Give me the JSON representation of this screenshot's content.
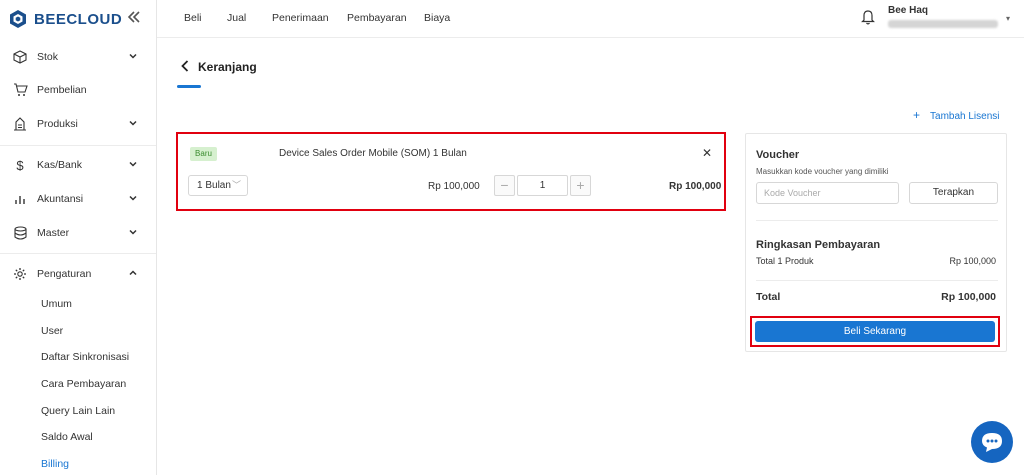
{
  "brand": {
    "name": "BEECLOUD"
  },
  "sidebar": {
    "items": [
      {
        "label": "Stok",
        "icon": "box-icon",
        "expandable": true
      },
      {
        "label": "Pembelian",
        "icon": "cart-icon",
        "expandable": false
      },
      {
        "label": "Produksi",
        "icon": "factory-icon",
        "expandable": true
      },
      {
        "label": "Kas/Bank",
        "icon": "dollar-icon",
        "expandable": true
      },
      {
        "label": "Akuntansi",
        "icon": "bar-chart-icon",
        "expandable": true
      },
      {
        "label": "Master",
        "icon": "database-icon",
        "expandable": true
      },
      {
        "label": "Pengaturan",
        "icon": "gear-icon",
        "expandable": true,
        "expanded": true
      }
    ],
    "sub_items": [
      "Umum",
      "User",
      "Daftar Sinkronisasi",
      "Cara Pembayaran",
      "Query Lain Lain",
      "Saldo Awal",
      "Billing"
    ],
    "active_sub_item": "Billing"
  },
  "topbar": {
    "menu": [
      "Beli",
      "Jual",
      "Penerimaan",
      "Pembayaran",
      "Biaya"
    ],
    "user_name": "Bee Haq"
  },
  "page": {
    "title": "Keranjang",
    "add_license": "Tambah Lisensi"
  },
  "cart": {
    "badge": "Baru",
    "product_name": "Device Sales Order Mobile (SOM) 1 Bulan",
    "duration": "1 Bulan",
    "unit_price": "Rp 100,000",
    "quantity": "1",
    "total_price": "Rp 100,000"
  },
  "summary": {
    "voucher_title": "Voucher",
    "voucher_hint": "Masukkan kode voucher yang dimiliki",
    "voucher_placeholder": "Kode Voucher",
    "apply_label": "Terapkan",
    "payment_summary_title": "Ringkasan Pembayaran",
    "products_label": "Total 1 Produk",
    "products_value": "Rp 100,000",
    "total_label": "Total",
    "total_value": "Rp 100,000",
    "buy_label": "Beli Sekarang"
  },
  "colors": {
    "accent": "#1976d2",
    "highlight": "#e1000f",
    "badge_bg": "#d6f0cf",
    "chat_bg": "#1565c0"
  }
}
